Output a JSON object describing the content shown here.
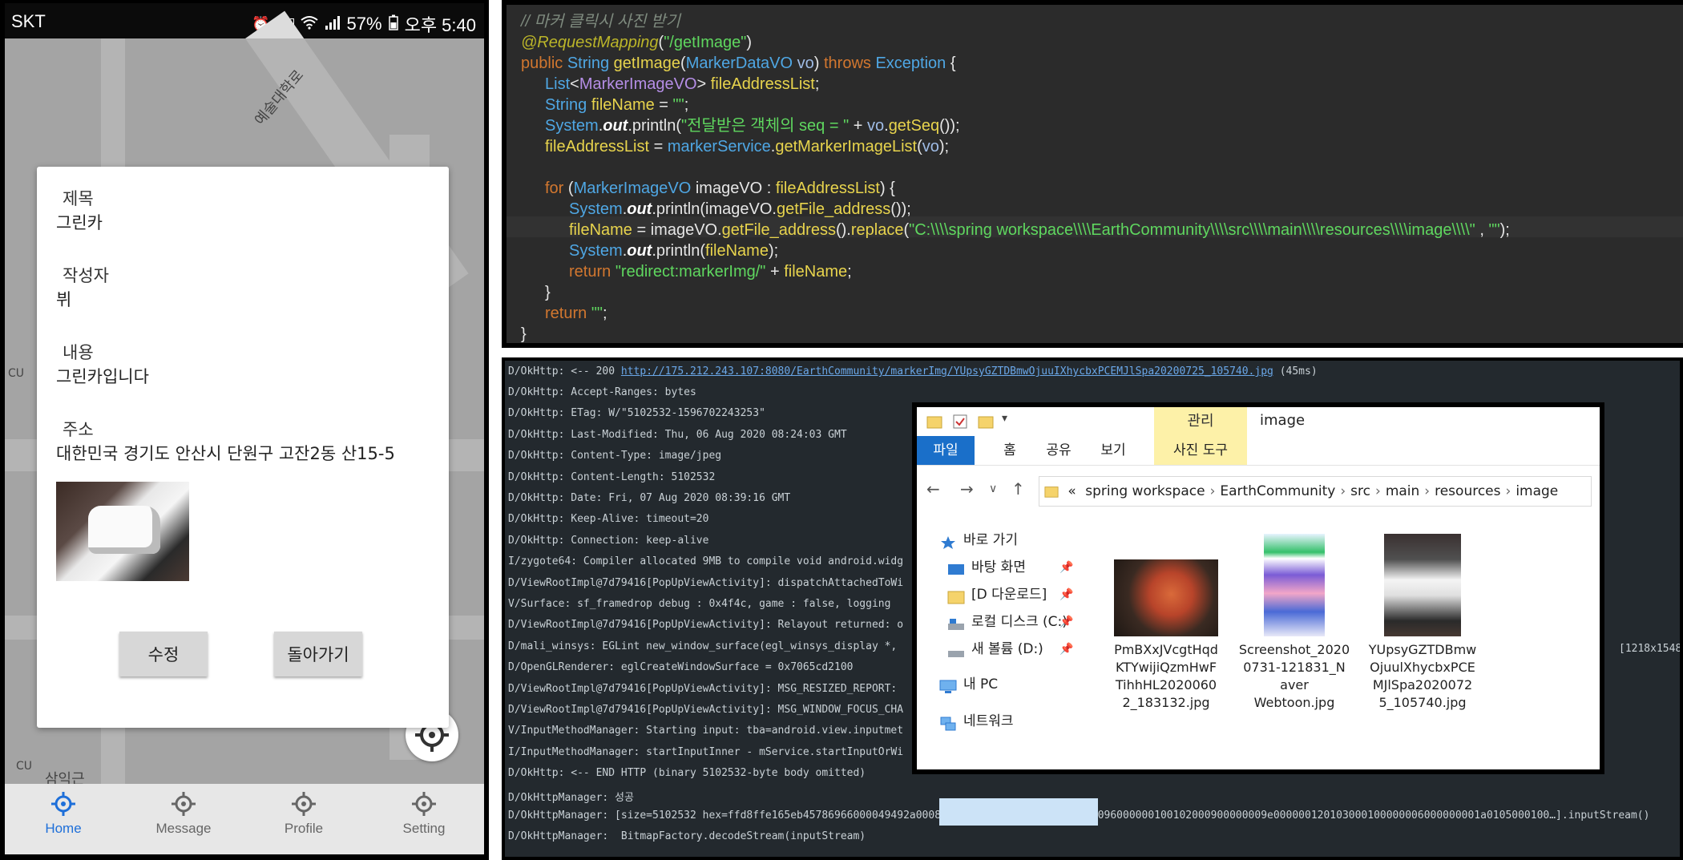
{
  "phone": {
    "status": {
      "carrier": "SKT",
      "battery": "57%",
      "time": "오후 5:40",
      "icons": [
        "alarm-icon",
        "hd-voice-icon",
        "wifi-icon",
        "signal-icon",
        "battery-icon"
      ]
    },
    "map_labels": [
      "예술대학로",
      "CU",
      "CU",
      "삼익근"
    ],
    "dialog": {
      "title_label": "제목",
      "title_value": "그린카",
      "author_label": "작성자",
      "author_value": "뷔",
      "content_label": "내용",
      "content_value": "그린카입니다",
      "address_label": "주소",
      "address_value": "대한민국 경기도 안산시 단원구 고잔2동 산15-5",
      "edit_button": "수정",
      "back_button": "돌아가기"
    },
    "nav": [
      {
        "label": "Home",
        "icon": "crosshair-icon",
        "active": true
      },
      {
        "label": "Message",
        "icon": "crosshair-icon",
        "active": false
      },
      {
        "label": "Profile",
        "icon": "crosshair-icon",
        "active": false
      },
      {
        "label": "Setting",
        "icon": "crosshair-icon",
        "active": false
      }
    ]
  },
  "code": {
    "lines": [
      "// 마커 클릭시 사진 받기",
      "@RequestMapping(\"/getImage\")",
      "public String getImage(MarkerDataVO vo) throws Exception {",
      "List<MarkerImageVO> fileAddressList;",
      "String fileName = \"\";",
      "System.out.println(\"전달받은 객체의 seq = \" + vo.getSeq());",
      "fileAddressList = markerService.getMarkerImageList(vo);",
      "",
      "for (MarkerImageVO imageVO : fileAddressList) {",
      "System.out.println(imageVO.getFile_address());",
      "fileName = imageVO.getFile_address().replace(\"C:\\\\\\\\spring workspace\\\\\\\\EarthCommunity\\\\\\\\src\\\\\\\\main\\\\\\\\resources\\\\\\\\image\\\\\\\\\" , \"\");",
      "System.out.println(fileName);",
      "return \"redirect:markerImg/\" + fileName;",
      "}",
      "return \"\";",
      "}"
    ]
  },
  "log": {
    "first_prefix": "D/OkHttp: <-- 200 ",
    "first_link": "http://175.212.243.107:8080/EarthCommunity/markerImg/YUpsyGZTDBmwOjuuIXhycbxPCEMJlSpa20200725_105740.jpg",
    "first_suffix": " (45ms)",
    "lines": [
      "D/OkHttp: Accept-Ranges: bytes",
      "D/OkHttp: ETag: W/\"5102532-1596702243253\"",
      "D/OkHttp: Last-Modified: Thu, 06 Aug 2020 08:24:03 GMT",
      "D/OkHttp: Content-Type: image/jpeg",
      "D/OkHttp: Content-Length: 5102532",
      "D/OkHttp: Date: Fri, 07 Aug 2020 08:39:16 GMT",
      "D/OkHttp: Keep-Alive: timeout=20",
      "D/OkHttp: Connection: keep-alive",
      "I/zygote64: Compiler allocated 9MB to compile void android.widg",
      "D/ViewRootImpl@7d79416[PopUpViewActivity]: dispatchAttachedToWi",
      "V/Surface: sf_framedrop debug : 0x4f4c, game : false, logging",
      "D/ViewRootImpl@7d79416[PopUpViewActivity]: Relayout returned: o",
      "D/mali_winsys: EGLint new_window_surface(egl_winsys_display *,",
      "D/OpenGLRenderer: eglCreateWindowSurface = 0x7065cd2100",
      "D/ViewRootImpl@7d79416[PopUpViewActivity]: MSG_RESIZED_REPORT:",
      "D/ViewRootImpl@7d79416[PopUpViewActivity]: MSG_WINDOW_FOCUS_CHA",
      "V/InputMethodManager: Starting input: tba=android.view.inputmet",
      "I/InputMethodManager: startInputInner - mService.startInputOrWi",
      "D/OkHttp: <-- END HTTP (binary 5102532-byte body omitted)",
      "D/OkHttpManager: 성공",
      "D/OkHttpManager: [size=5102532 hex=ffd8ffe165eb45786966000049492a00080000000a000f0102000800000096000000100102000900000009e000000120103000100000006000000001a0105000100…].inputStream()",
      "D/OkHttpManager:  BitmapFactory.decodeStream(inputStream)"
    ],
    "side_note": "[1218x1548"
  },
  "explorer": {
    "title": "image",
    "manage_tab": "관리",
    "tabs": [
      "파일",
      "홈",
      "공유",
      "보기",
      "사진 도구"
    ],
    "path_prefix": "«",
    "path": [
      "spring workspace",
      "EarthCommunity",
      "src",
      "main",
      "resources",
      "image"
    ],
    "tree": [
      {
        "label": "바로 가기",
        "icon": "star-icon",
        "pinned": false
      },
      {
        "label": "바탕 화면",
        "icon": "desktop-icon",
        "pinned": true
      },
      {
        "label": "[D 다운로드]",
        "icon": "folder-icon",
        "pinned": true
      },
      {
        "label": "로컬 디스크 (C:)",
        "icon": "drive-icon",
        "pinned": true
      },
      {
        "label": "새 볼륨 (D:)",
        "icon": "drive-icon",
        "pinned": true
      },
      {
        "label": "내 PC",
        "icon": "pc-icon",
        "pinned": false
      },
      {
        "label": "네트워크",
        "icon": "network-icon",
        "pinned": false
      }
    ],
    "files": [
      {
        "name": "PmBXxJVcgtHqdKTYwijiQzmHwFTihhHL20200602_183132.jpg",
        "lines": [
          "PmBXxJVcgtHqd",
          "KTYwijiQzmHwF",
          "TihhHL2020060",
          "2_183132.jpg"
        ]
      },
      {
        "name": "Screenshot_20200731-121831_Naver Webtoon.jpg",
        "lines": [
          "Screenshot_2020",
          "0731-121831_N",
          "aver",
          "Webtoon.jpg"
        ]
      },
      {
        "name": "YUpsyGZTDBmwOjuulXhycbxPCEMJlSpa20200725_105740.jpg",
        "lines": [
          "YUpsyGZTDBmw",
          "OjuulXhycbxPCE",
          "MJlSpa2020072",
          "5_105740.jpg"
        ]
      }
    ]
  }
}
